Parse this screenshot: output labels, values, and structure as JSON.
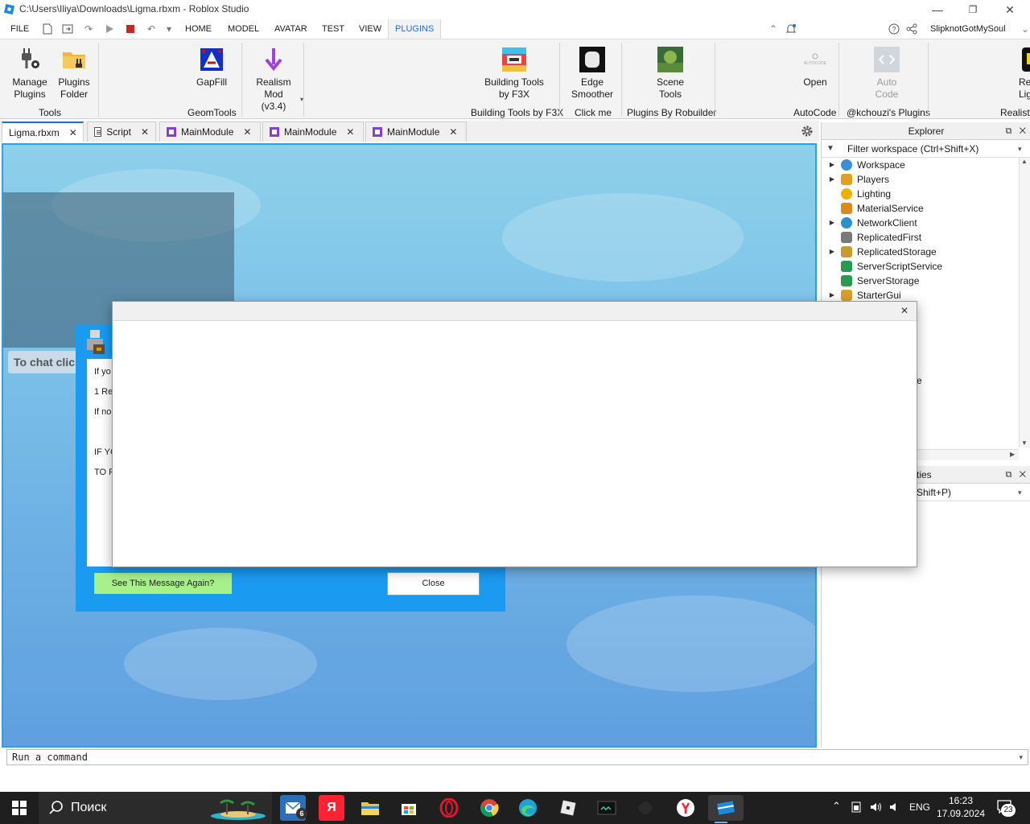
{
  "window": {
    "title": "C:\\Users\\Iliya\\Downloads\\Ligma.rbxm - Roblox Studio",
    "minimize": "—",
    "restore": "❐",
    "close": "✕"
  },
  "menu": {
    "items": [
      "FILE",
      "HOME",
      "MODEL",
      "AVATAR",
      "TEST",
      "VIEW",
      "PLUGINS"
    ],
    "active": "PLUGINS",
    "user": "SlipknotGotMySoul"
  },
  "ribbon": {
    "buttons": [
      {
        "line1": "Manage",
        "line2": "Plugins"
      },
      {
        "line1": "Plugins",
        "line2": "Folder"
      },
      {
        "line1": "GapFill",
        "line2": ""
      },
      {
        "line1": "Realism Mod",
        "line2": "(v3.4)"
      },
      {
        "line1": "Building Tools",
        "line2": "by F3X"
      },
      {
        "line1": "Edge",
        "line2": "Smoother"
      },
      {
        "line1": "Scene",
        "line2": "Tools"
      },
      {
        "line1": "Open",
        "line2": ""
      },
      {
        "line1": "Auto",
        "line2": "Code"
      },
      {
        "line1": "Re",
        "line2": "Lig"
      }
    ],
    "groups": [
      "Tools",
      "GeomTools",
      "Building Tools by F3X",
      "Click me",
      "Plugins By Robuilder",
      "AutoCode",
      "@kchouzi's Plugins",
      "Realisti"
    ],
    "icon_text_scene": "Scene\nTools",
    "icon_text_autocode": "AUTOCODE",
    "icon_text_code": "<>"
  },
  "tabs": [
    {
      "label": "Ligma.rbxm",
      "active": true
    },
    {
      "label": "Script"
    },
    {
      "label": "MainModule"
    },
    {
      "label": "MainModule"
    },
    {
      "label": "MainModule"
    }
  ],
  "viewport": {
    "chat_hint": "To chat click"
  },
  "plugin_dialog": {
    "lines": [
      "If yo",
      "1 Re",
      "If no",
      "IF YC",
      "TO R"
    ],
    "see_again": "See This Message Again?",
    "close": "Close"
  },
  "explorer": {
    "title": "Explorer",
    "filter_placeholder": "Filter workspace (Ctrl+Shift+X)",
    "items": [
      {
        "name": "Workspace",
        "expandable": true,
        "color": "#3a8fd8"
      },
      {
        "name": "Players",
        "expandable": true,
        "color": "#e0a020"
      },
      {
        "name": "Lighting",
        "expandable": false,
        "color": "#f0b000"
      },
      {
        "name": "MaterialService",
        "expandable": false,
        "color": "#d88a20"
      },
      {
        "name": "NetworkClient",
        "expandable": true,
        "color": "#2c8fd0"
      },
      {
        "name": "ReplicatedFirst",
        "expandable": false,
        "color": "#7a7a7a"
      },
      {
        "name": "ReplicatedStorage",
        "expandable": true,
        "color": "#c89a30"
      },
      {
        "name": "ServerScriptService",
        "expandable": false,
        "color": "#2a9a50"
      },
      {
        "name": "ServerStorage",
        "expandable": false,
        "color": "#2a9a50"
      },
      {
        "name": "StarterGui",
        "expandable": true,
        "color": "#d8a030"
      }
    ],
    "partial_text": "e"
  },
  "properties": {
    "title_partial": "ties",
    "filter_partial": "Shift+P)"
  },
  "command_bar": {
    "placeholder": "Run a command"
  },
  "taskbar": {
    "search": "Поиск",
    "mail_badge": "6",
    "lang": "ENG",
    "time": "16:23",
    "date": "17.09.2024",
    "notif_count": "23"
  }
}
